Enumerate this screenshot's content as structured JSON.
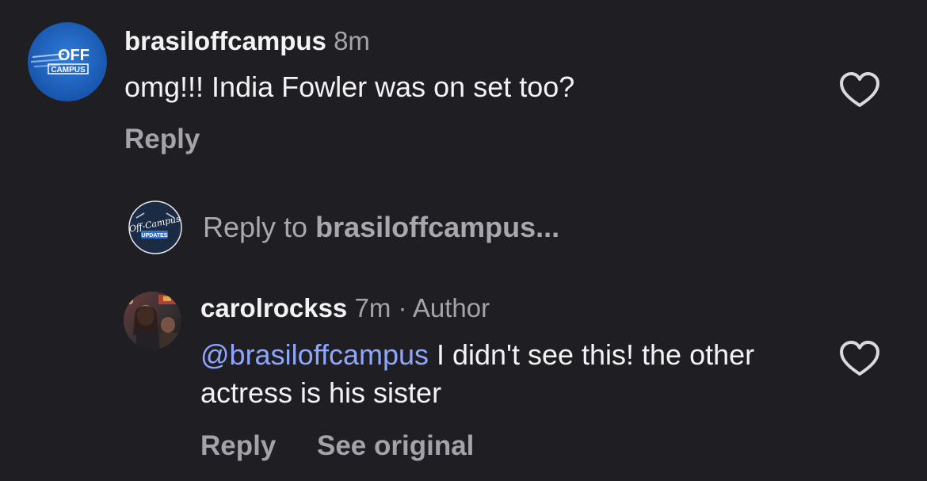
{
  "comments": [
    {
      "username": "brasiloffcampus",
      "time": "8m",
      "text": "omg!!! India Fowler was on set too?",
      "actions": {
        "reply": "Reply"
      },
      "avatar_logo": {
        "line1": "OFF",
        "line2": "CAMPUS"
      },
      "like_icon": "heart-outline-icon"
    },
    {
      "username": "carolrockss",
      "time": "7m",
      "separator": "·",
      "badge": "Author",
      "mention": "@brasiloffcampus",
      "text": " I didn't see this! the other actress is his sister",
      "actions": {
        "reply": "Reply",
        "see_original": "See original"
      },
      "like_icon": "heart-outline-icon"
    }
  ],
  "reply_composer": {
    "prefix": "Reply to ",
    "target": "brasiloffcampus",
    "suffix": "...",
    "avatar_logo": {
      "line1": "Off-Campus",
      "line2": "UPDATES"
    }
  },
  "colors": {
    "background": "#1f1f23",
    "primary_text": "#f3f3f5",
    "secondary_text": "#a3a3ab",
    "mention": "#8ea6ff"
  }
}
